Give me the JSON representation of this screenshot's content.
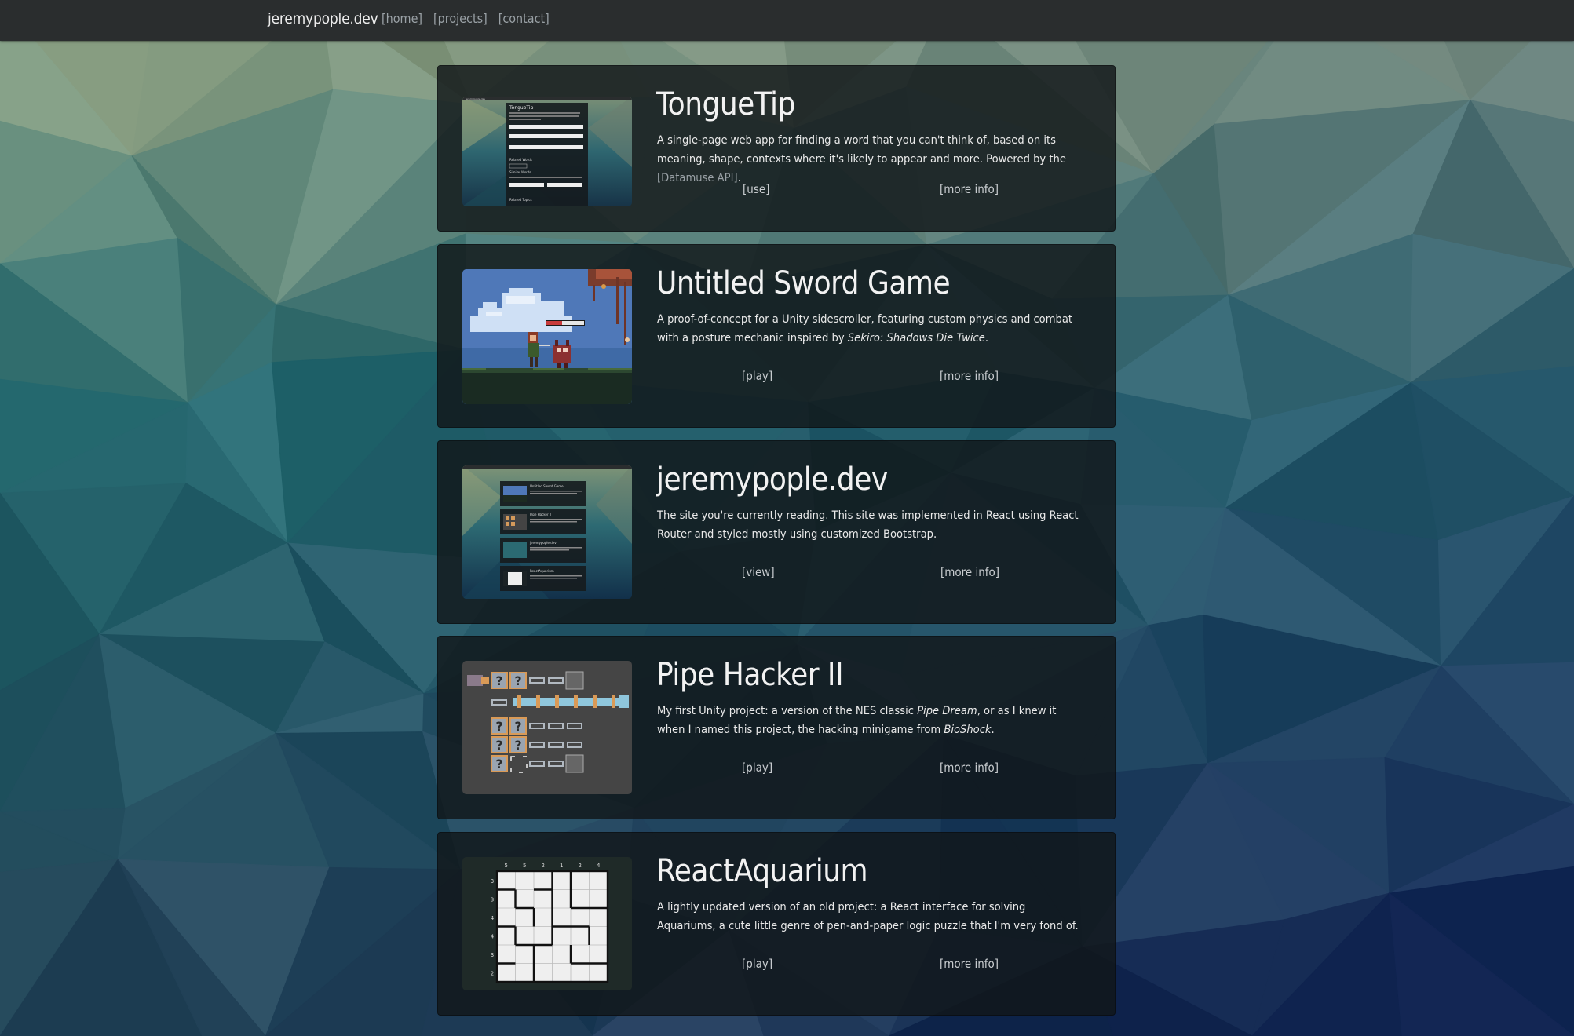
{
  "site": {
    "brand": "jeremypople.dev",
    "nav": [
      "[home]",
      "[projects]",
      "[contact]"
    ]
  },
  "projects": [
    {
      "title": "TongueTip",
      "desc_pre": "A single-page web app for finding a word that you can't think of, based on its meaning, shape, contexts where it's likely to appear and more. Powered by the ",
      "desc_link": "[Datamuse API]",
      "desc_post": ".",
      "action": "[use]",
      "more": "[more info]"
    },
    {
      "title": "Untitled Sword Game",
      "desc_pre": "A proof-of-concept for a Unity sidescroller, featuring custom physics and combat with a posture mechanic inspired by ",
      "desc_em": "Sekiro: Shadows Die Twice",
      "desc_post": ".",
      "action": "[play]",
      "more": "[more info]"
    },
    {
      "title": "jeremypople.dev",
      "desc_pre": "The site you're currently reading. This site was implemented in React using React Router and styled mostly using customized Bootstrap.",
      "action": "[view]",
      "more": "[more info]"
    },
    {
      "title": "Pipe Hacker II",
      "desc_pre": "My first Unity project: a version of the NES classic ",
      "desc_em": "Pipe Dream",
      "desc_mid": ", or as I knew it when I named this project, the hacking minigame from ",
      "desc_em2": "BioShock",
      "desc_post": ".",
      "action": "[play]",
      "more": "[more info]"
    },
    {
      "title": "ReactAquarium",
      "desc_pre": "A lightly updated version of an old project: a React interface for solving Aquariums, a cute little genre of pen-and-paper logic puzzle that I'm very fond of.",
      "action": "[play]",
      "more": "[more info]"
    }
  ],
  "thumbnails": {
    "tonguetip": {
      "title": "TongueTip",
      "nav": "jeremypople.dev",
      "labels": [
        "Related Words",
        "Similar Words",
        "Related Topics"
      ]
    },
    "site": {
      "titles": [
        "Untitled Sword Game",
        "Pipe Hacker II",
        "jeremypople.dev",
        "ReactAquarium"
      ]
    },
    "aquarium": {
      "col_clues": [
        "5",
        "5",
        "2",
        "1",
        "2",
        "4"
      ],
      "row_clues": [
        "3",
        "3",
        "4",
        "4",
        "3",
        "2"
      ]
    },
    "pipe_glyph": "?"
  },
  "colors": {
    "navbar": "#2a2d2e",
    "card_bg": "rgba(17,22,24,0.82)",
    "link": "#9aa1a6",
    "text": "#e9e9e9"
  }
}
